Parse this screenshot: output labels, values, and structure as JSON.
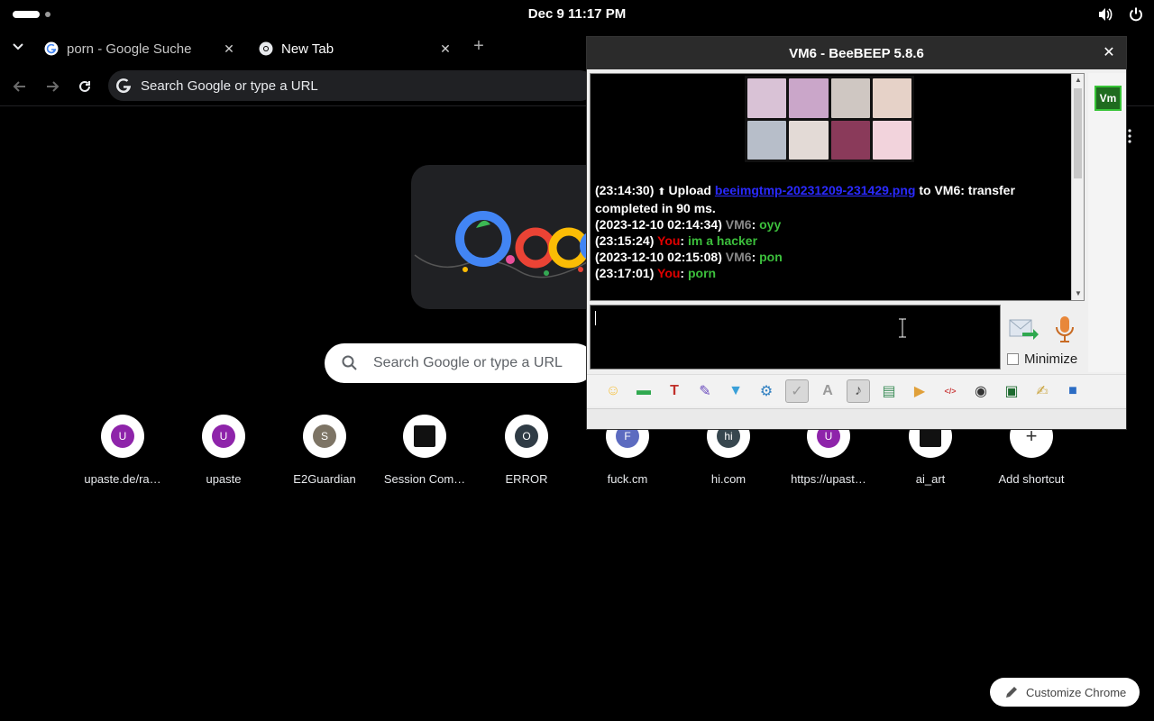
{
  "system": {
    "clock": "Dec 9  11:17 PM",
    "icons": [
      "volume-icon",
      "power-icon"
    ]
  },
  "browser": {
    "tabs": [
      {
        "title": "porn - Google Suche",
        "favicon": "google-icon",
        "active": false
      },
      {
        "title": "New Tab",
        "favicon": "chrome-icon",
        "active": true
      }
    ],
    "omnibox_placeholder": "Search Google or type a URL",
    "ntp": {
      "search_placeholder": "Search Google or type a URL",
      "shortcuts": [
        {
          "label": "upaste.de/ra…",
          "letter": "U",
          "color": "#8e24aa"
        },
        {
          "label": "upaste",
          "letter": "U",
          "color": "#8e24aa"
        },
        {
          "label": "E2Guardian",
          "letter": "S",
          "color": "#7d7465"
        },
        {
          "label": "Session Com…",
          "letter": "",
          "color": "#111111"
        },
        {
          "label": "ERROR",
          "letter": "O",
          "color": "#2f3b45"
        },
        {
          "label": "fuck.cm",
          "letter": "F",
          "color": "#5c6bc0"
        },
        {
          "label": "hi.com",
          "letter": "hi",
          "color": "#37474f"
        },
        {
          "label": "https://upast…",
          "letter": "U",
          "color": "#8e24aa"
        },
        {
          "label": "ai_art",
          "letter": "",
          "color": "#111111"
        },
        {
          "label": "Add shortcut",
          "letter": "+",
          "color": "#ffffff"
        }
      ],
      "customize_label": "Customize Chrome"
    }
  },
  "beebeep": {
    "title": "VM6 - BeeBEEP 5.8.6",
    "user_badge": "Vm",
    "messages": [
      {
        "time": "(23:14:30)",
        "pre": "Upload ",
        "link": "beeimgtmp-20231209-231429.png",
        "post": " to VM6: transfer completed in 90 ms."
      },
      {
        "time": "(2023-12-10 02:14:34)",
        "user": "VM6",
        "text": "oyy"
      },
      {
        "time": "(23:15:24)",
        "user": "You",
        "text": "im a hacker"
      },
      {
        "time": "(2023-12-10 02:15:08)",
        "user": "VM6",
        "text": "pon"
      },
      {
        "time": "(23:17:01)",
        "user": "You",
        "text": "porn"
      }
    ],
    "input_value": "",
    "minimize_label": "Minimize",
    "toolbar_icons": [
      "emoji-icon",
      "bee-icon",
      "font-icon",
      "color-palette-icon",
      "filter-icon",
      "settings-icon",
      "spellcheck-icon",
      "text-completion-icon",
      "music-note-icon",
      "send-file-icon",
      "folder-share-icon",
      "html-icon",
      "screenshot-icon",
      "terminal-icon",
      "notes-icon",
      "save-icon"
    ]
  }
}
